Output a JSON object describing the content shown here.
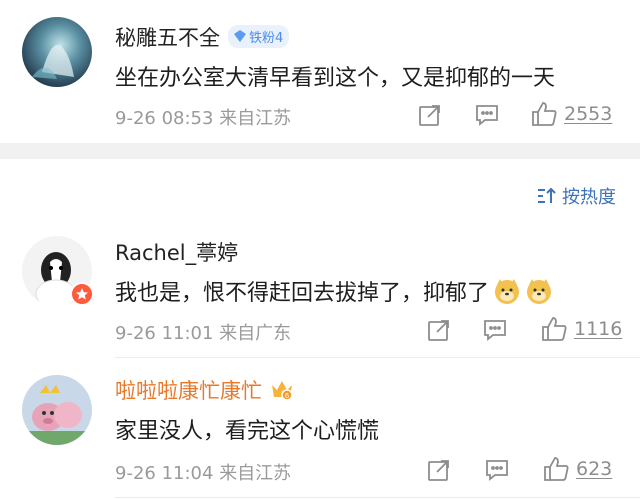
{
  "sort": {
    "label": "按热度"
  },
  "comments": [
    {
      "name": "秘雕五不全",
      "badge": "铁粉4",
      "text": "坐在办公室大清早看到这个，又是抑郁的一天",
      "meta": "9-26 08:53  来自江苏",
      "likes": "2553",
      "name_color": "#333333"
    },
    {
      "name": "Rachel_葶婷",
      "text": "我也是，恨不得赶回去拔掉了，抑郁了",
      "meta": "9-26 11:01  来自广东",
      "likes": "1116",
      "name_color": "#333333"
    },
    {
      "name": "啦啦啦康忙康忙",
      "text": "家里没人，看完这个心慌慌",
      "meta": "9-26 11:04  来自江苏",
      "likes": "623",
      "name_color": "#e8792b"
    }
  ],
  "icons": [
    "share-icon",
    "comment-icon",
    "like-icon",
    "sort-icon",
    "fan-badge-icon",
    "verified-icon",
    "vip-crown-icon",
    "doge-emoji"
  ]
}
